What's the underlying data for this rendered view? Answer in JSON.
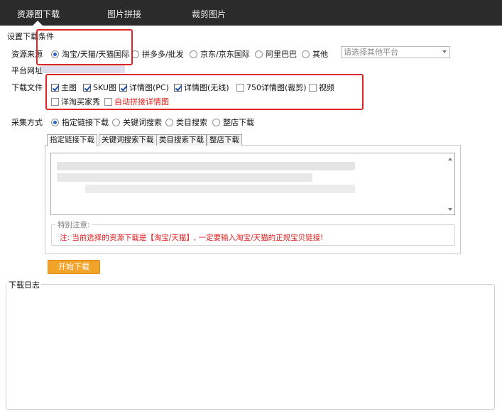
{
  "tabs": [
    {
      "label": "资源图下载",
      "active": true
    },
    {
      "label": "图片拼接",
      "active": false
    },
    {
      "label": "裁剪图片",
      "active": false
    }
  ],
  "settings": {
    "title": "设置下载条件",
    "source_label": "资源来源",
    "source_options": [
      "淘宝/天猫/天猫国际",
      "拼多多/批发",
      "京东/京东国际",
      "阿里巴巴",
      "其他"
    ],
    "source_selected": "淘宝/天猫/天猫国际",
    "other_platform_placeholder": "请选择其他平台",
    "platform_url_label": "平台网址",
    "download_files_label": "下载文件",
    "file_options": [
      {
        "label": "主图",
        "checked": true
      },
      {
        "label": "SKU图",
        "checked": true
      },
      {
        "label": "详情图(PC)",
        "checked": true
      },
      {
        "label": "详情图(无线)",
        "checked": true
      },
      {
        "label": "750详情图(裁剪)",
        "checked": false
      },
      {
        "label": "视频",
        "checked": false
      },
      {
        "label": "洋淘买家秀",
        "checked": false
      },
      {
        "label": "自动拼接详情图",
        "checked": false
      }
    ],
    "collect_label": "采集方式",
    "collect_options": [
      "指定链接下载",
      "关键词搜索",
      "类目搜索",
      "整店下载"
    ],
    "collect_selected": "指定链接下载"
  },
  "subtabs": [
    "指定链接下载",
    "关键词搜索下载",
    "类目搜索下载",
    "整店下载"
  ],
  "notice": {
    "legend": "特别注意:",
    "text": "注: 当前选择的资源下载是【淘宝/天猫】, 一定要输入淘宝/天猫的正规宝贝链接!"
  },
  "start_button": "开始下载",
  "log_title": "下载日志",
  "colors": {
    "topbar": "#2b2b2b",
    "highlight_box": "#e02525",
    "button": "#f2a42a",
    "warning_text": "#e01c1c",
    "radio_checked": "#2a62c9"
  }
}
